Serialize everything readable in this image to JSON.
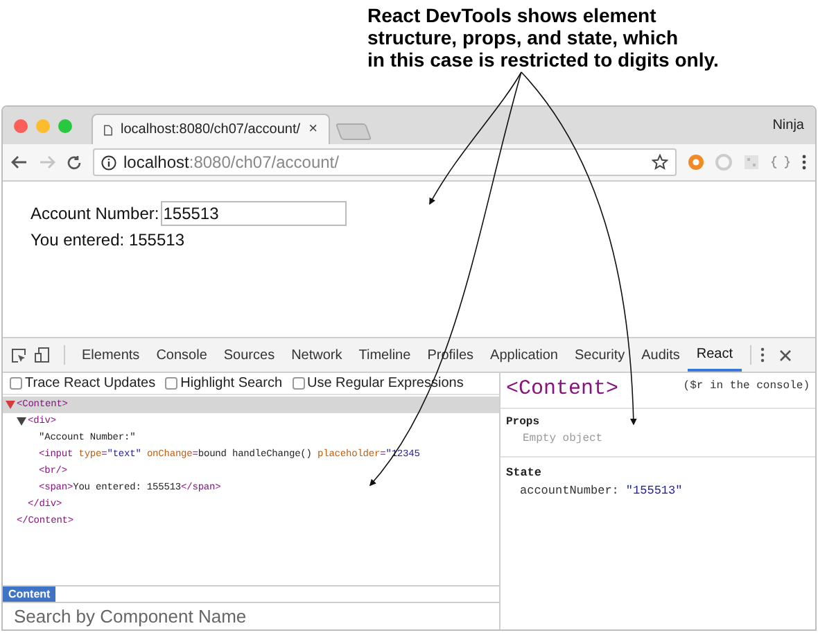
{
  "caption": {
    "lines": [
      "React DevTools shows element",
      "structure, props, and state, which",
      "in this case is restricted to digits only."
    ]
  },
  "browser": {
    "tab": {
      "title": "localhost:8080/ch07/account/",
      "close": "×"
    },
    "profile": "Ninja",
    "address": {
      "host": "localhost",
      "path": ":8080/ch07/account/"
    },
    "forward_disabled": true
  },
  "page": {
    "label": "Account Number:",
    "value": "155513",
    "echo": "You entered: 155513"
  },
  "devtools": {
    "tabs": [
      {
        "label": "Elements",
        "selected": false
      },
      {
        "label": "Console",
        "selected": false
      },
      {
        "label": "Sources",
        "selected": false
      },
      {
        "label": "Network",
        "selected": false
      },
      {
        "label": "Timeline",
        "selected": false
      },
      {
        "label": "Profiles",
        "selected": false
      },
      {
        "label": "Application",
        "selected": false
      },
      {
        "label": "Security",
        "selected": false
      },
      {
        "label": "Audits",
        "selected": false
      },
      {
        "label": "React",
        "selected": true
      }
    ],
    "options": [
      {
        "label": "Trace React Updates",
        "checked": false
      },
      {
        "label": "Highlight Search",
        "checked": false
      },
      {
        "label": "Use Regular Expressions",
        "checked": false
      }
    ],
    "tree": [
      {
        "expanded": true,
        "selected": true,
        "open": [
          {
            "kind": "tag",
            "text": "<Content>"
          }
        ],
        "close": [
          {
            "kind": "tag",
            "text": "</Content>"
          }
        ],
        "children": [
          {
            "expanded": true,
            "selected": false,
            "open": [
              {
                "kind": "tag",
                "text": "<div>"
              }
            ],
            "close": [
              {
                "kind": "tag",
                "text": "</div>"
              }
            ],
            "children": [
              {
                "open": [
                  {
                    "kind": "text",
                    "text": "\"Account Number:\""
                  }
                ]
              },
              {
                "open": [
                  {
                    "kind": "tag",
                    "text": "<input "
                  },
                  {
                    "kind": "attr",
                    "text": "type"
                  },
                  {
                    "kind": "tag",
                    "text": "="
                  },
                  {
                    "kind": "value",
                    "text": "\"text\" "
                  },
                  {
                    "kind": "attr",
                    "text": "onChange"
                  },
                  {
                    "kind": "tag",
                    "text": "="
                  },
                  {
                    "kind": "text",
                    "text": "bound handleChange() "
                  },
                  {
                    "kind": "attr",
                    "text": "placeholder"
                  },
                  {
                    "kind": "tag",
                    "text": "="
                  },
                  {
                    "kind": "value",
                    "text": "\"12345"
                  }
                ]
              },
              {
                "open": [
                  {
                    "kind": "tag",
                    "text": "<br/>"
                  }
                ]
              },
              {
                "open": [
                  {
                    "kind": "tag",
                    "text": "<span>"
                  },
                  {
                    "kind": "text",
                    "text": "You entered: 155513"
                  },
                  {
                    "kind": "tag",
                    "text": "</span>"
                  }
                ]
              }
            ]
          }
        ]
      }
    ],
    "side": {
      "component": "<Content>",
      "hint": "($r in the console)",
      "props_title": "Props",
      "props_empty": "Empty object",
      "state_title": "State",
      "state_key": "accountNumber:",
      "state_value": "\"155513\""
    },
    "breadcrumb": [
      {
        "label": "Content",
        "selected": true
      }
    ],
    "search": {
      "placeholder": "Search by Component Name"
    }
  }
}
